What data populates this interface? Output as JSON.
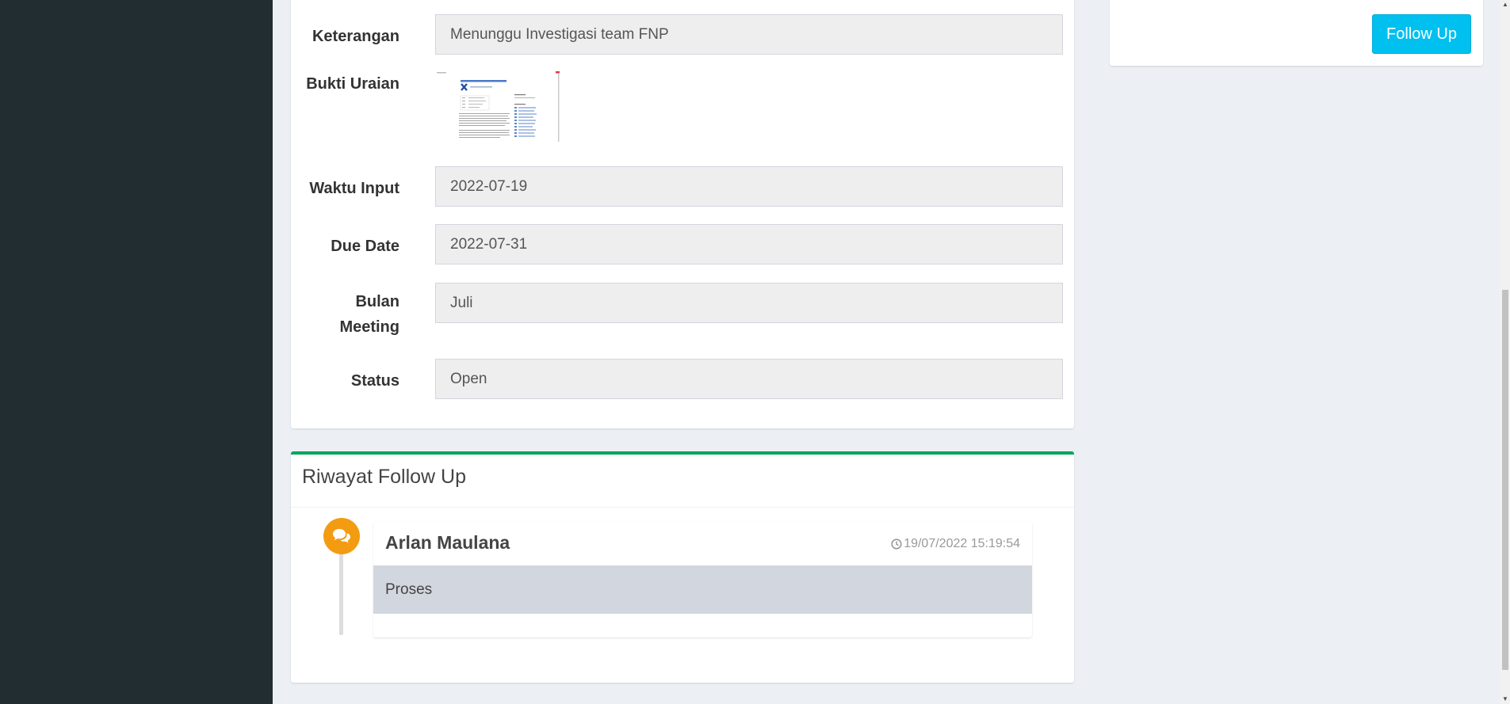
{
  "form": {
    "keterangan_label": "Keterangan",
    "keterangan_value": "Menunggu Investigasi team FNP",
    "bukti_label": "Bukti Uraian",
    "waktu_label": "Waktu Input",
    "waktu_value": "2022-07-19",
    "due_label": "Due Date",
    "due_value": "2022-07-31",
    "bulan_label_1": "Bulan",
    "bulan_label_2": "Meeting",
    "bulan_value": "Juli",
    "status_label": "Status",
    "status_value": "Open"
  },
  "actions": {
    "follow_up": "Follow Up"
  },
  "history": {
    "title": "Riwayat Follow Up",
    "items": [
      {
        "author": "Arlan Maulana",
        "time": "19/07/2022 15:19:54",
        "body": "Proses"
      }
    ]
  },
  "colors": {
    "accent": "#00c0ef",
    "timeline_icon": "#f39c12",
    "box_success": "#00a65a",
    "sidebar": "#222d32"
  }
}
